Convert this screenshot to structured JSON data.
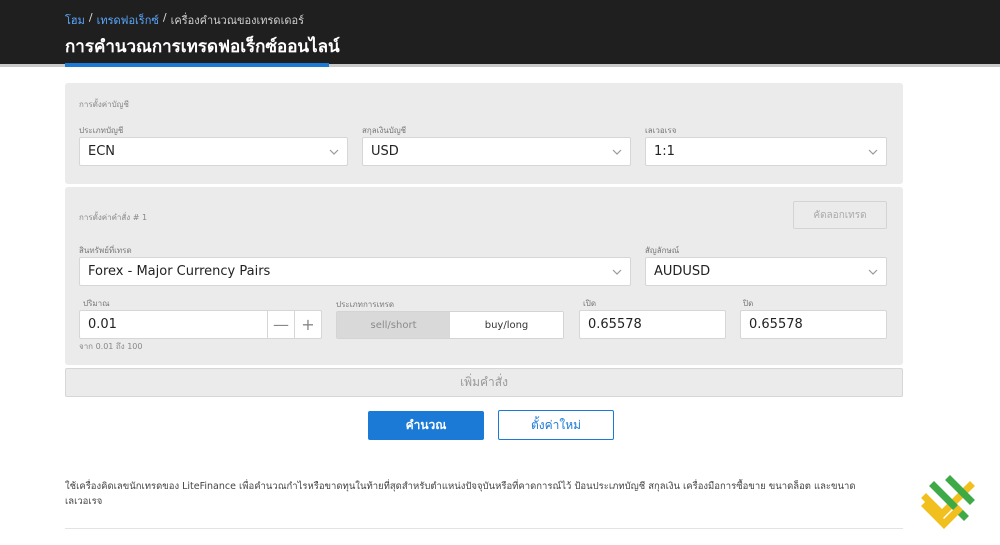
{
  "header": {
    "breadcrumb": {
      "home": "โฮม",
      "forex": "เทรดฟอเร็กซ์",
      "current": "เครื่องคำนวณของเทรดเดอร์",
      "separator": "/"
    },
    "title": "การคำนวณการเทรดฟอเร็กซ์ออนไลน์"
  },
  "account": {
    "section_label": "การตั้งค่าบัญชี",
    "account_type": {
      "label": "ประเภทบัญชี",
      "value": "ECN"
    },
    "currency": {
      "label": "สกุลเงินบัญชี",
      "value": "USD"
    },
    "leverage": {
      "label": "เลเวอเรจ",
      "value": "1:1"
    }
  },
  "order": {
    "section_label": "การตั้งค่าคำสั่ง # 1",
    "copy_button": "คัดลอกเทรด",
    "instrument": {
      "label": "สินทรัพย์ที่เทรด",
      "value": "Forex - Major Currency Pairs"
    },
    "symbol": {
      "label": "สัญลักษณ์",
      "value": "AUDUSD"
    },
    "volume": {
      "label": "ปริมาณ",
      "value": "0.01",
      "hint": "จาก 0.01 ถึง 100",
      "minus": "—",
      "plus": "+"
    },
    "trade_type": {
      "label": "ประเภทการเทรด",
      "sell": "sell/short",
      "buy": "buy/long",
      "selected": "buy/long"
    },
    "open": {
      "label": "เปิด",
      "value": "0.65578"
    },
    "close": {
      "label": "ปิด",
      "value": "0.65578"
    }
  },
  "actions": {
    "add_order": "เพิ่มคำสั่ง",
    "calculate": "คำนวณ",
    "reset": "ตั้งค่าใหม่"
  },
  "description": "ใช้เครื่องคิดเลขนักเทรดของ LiteFinance เพื่อคำนวณกำไรหรือขาดทุนในท้ายที่สุดสำหรับตำแหน่งปัจจุบันหรือที่คาดการณ์ไว้ ป้อนประเภทบัญชี สกุลเงิน เครื่องมือการซื้อขาย ขนาดล็อต และขนาดเลเวอเรจ",
  "colors": {
    "accent": "#1a7ad6",
    "header_bg": "#1f1f1f",
    "panel_bg": "#ebebeb",
    "logo_green": "#3daa47",
    "logo_yellow": "#f2c01e"
  },
  "icons": {
    "dropdown": "chevron-down-icon",
    "logo": "litefinance-logo"
  }
}
